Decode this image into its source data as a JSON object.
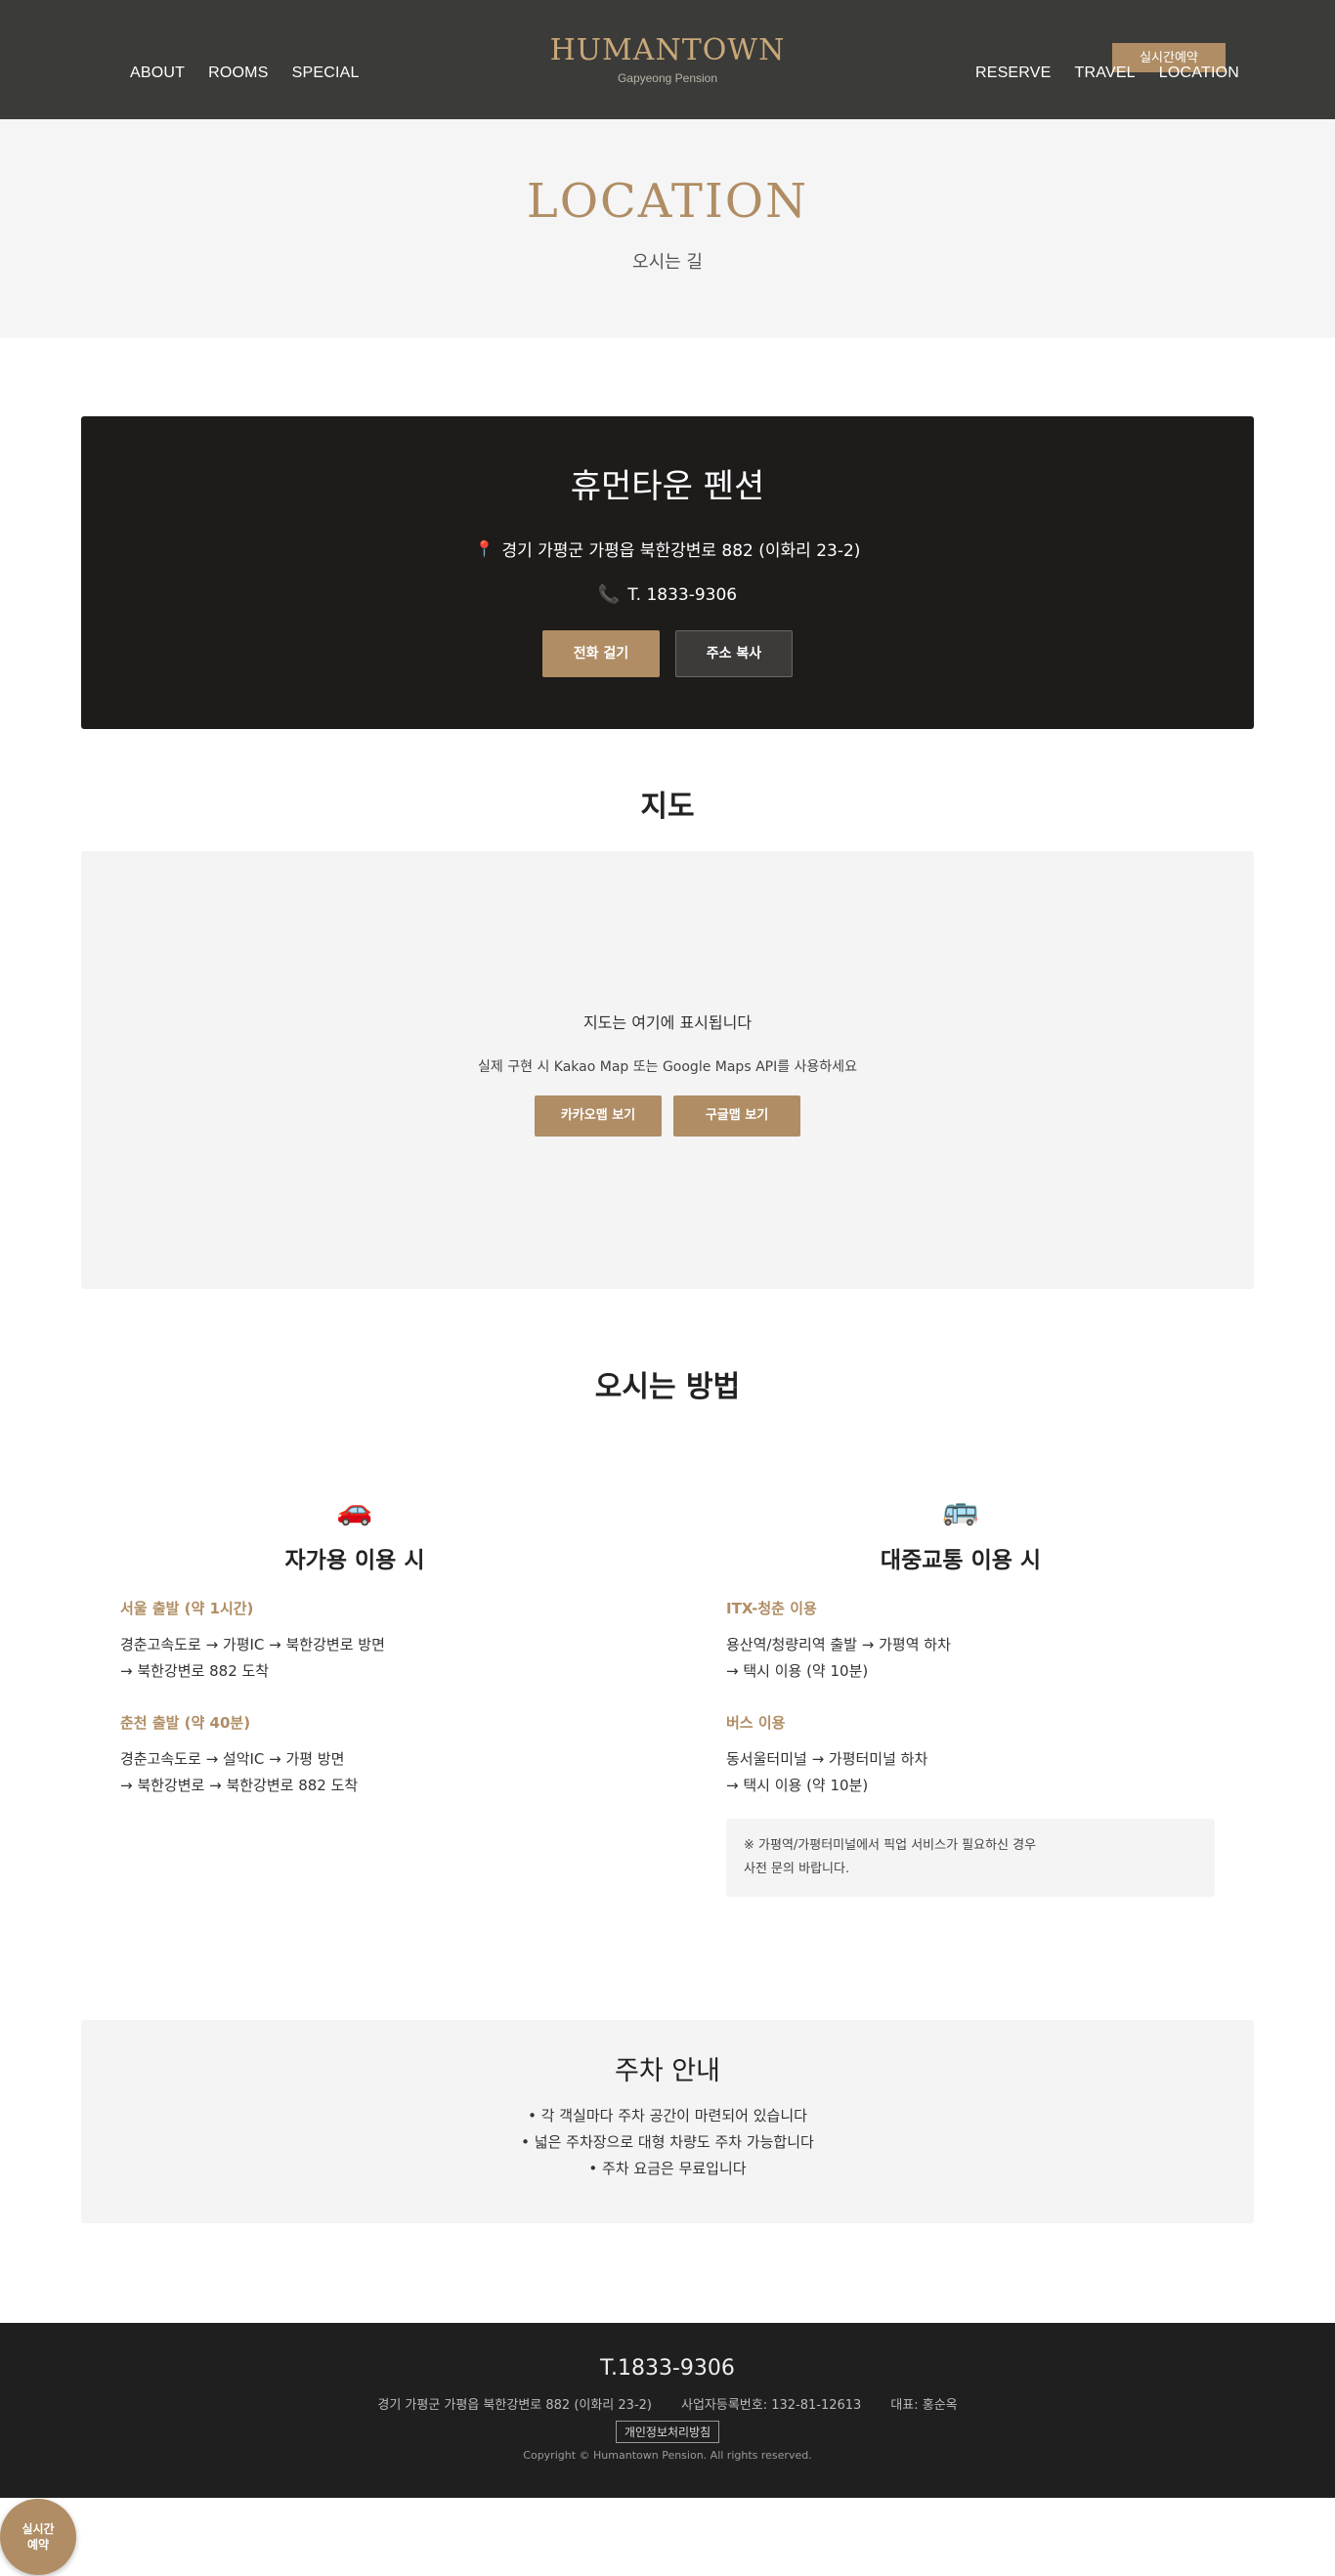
{
  "header": {
    "nav_left": [
      "ABOUT",
      "ROOMS",
      "SPECIAL"
    ],
    "nav_right": [
      "RESERVE",
      "TRAVEL",
      "LOCATION"
    ],
    "brand": "HUMANTOWN",
    "brand_sub": "Gapyeong Pension",
    "reserve_label": "실시간예약"
  },
  "hero": {
    "title": "LOCATION",
    "subtitle": "오시는 길"
  },
  "info": {
    "name": "휴먼타운 펜션",
    "address": "경기 가평군 가평읍 북한강변로 882 (이화리 23-2)",
    "phone": "T. 1833-9306",
    "call_label": "전화 걸기",
    "copy_label": "주소 복사"
  },
  "map": {
    "title": "지도",
    "placeholder": "지도는 여기에 표시됩니다",
    "hint": "실제 구현 시 Kakao Map 또는 Google Maps API를 사용하세요",
    "kakao_label": "카카오맵 보기",
    "google_label": "구글맵 보기"
  },
  "directions": {
    "title": "오시는 방법",
    "car": {
      "emoji": "🚗",
      "title": "자가용 이용 시",
      "routes": [
        {
          "heading": "서울 출발 (약 1시간)",
          "line1": "경춘고속도로 → 가평IC → 북한강변로 방면",
          "line2": "→ 북한강변로 882 도착"
        },
        {
          "heading": "춘천 출발 (약 40분)",
          "line1": "경춘고속도로 → 설악IC → 가평 방면",
          "line2": "→ 북한강변로 → 북한강변로 882 도착"
        }
      ]
    },
    "transit": {
      "emoji": "🚌",
      "title": "대중교통 이용 시",
      "routes": [
        {
          "heading": "ITX-청춘 이용",
          "line1": "용산역/청량리역 출발 → 가평역 하차",
          "line2": "→ 택시 이용 (약 10분)"
        },
        {
          "heading": "버스 이용",
          "line1": "동서울터미널 → 가평터미널 하차",
          "line2": "→ 택시 이용 (약 10분)"
        }
      ],
      "note_line1": "※ 가평역/가평터미널에서 픽업 서비스가 필요하신 경우",
      "note_line2": "사전 문의 바랍니다."
    }
  },
  "parking": {
    "title": "주차 안내",
    "items": [
      "• 각 객실마다 주차 공간이 마련되어 있습니다",
      "• 넓은 주차장으로 대형 차량도 주차 가능합니다",
      "• 주차 요금은 무료입니다"
    ]
  },
  "footer": {
    "tel": "T.1833-9306",
    "address": "경기 가평군 가평읍 북한강변로 882 (이화리 23-2)",
    "business_no": "사업자등록번호: 132-81-12613",
    "ceo": "대표: 홍순옥",
    "privacy": "개인정보처리방침",
    "copyright": "Copyright © Humantown Pension. All rights reserved."
  },
  "floating": {
    "line1": "실시간",
    "line2": "예약"
  },
  "colors": {
    "accent": "#b08d64",
    "header_bg": "#3b3b39",
    "card_bg": "#1e1c1b",
    "icon_pink": "#e04b6b"
  }
}
